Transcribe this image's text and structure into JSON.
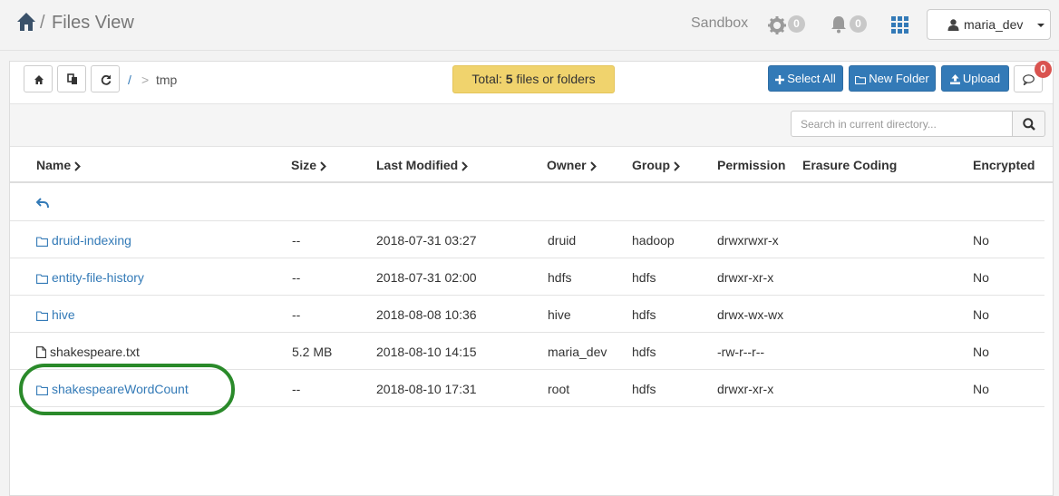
{
  "header": {
    "breadcrumb_sep": "/",
    "title": "Files View",
    "sandbox": "Sandbox",
    "settings_count": "0",
    "notifications_count": "0",
    "user": "maria_dev",
    "icons": [
      "home-icon",
      "gear-icon",
      "bell-icon",
      "apps-grid-icon",
      "user-icon",
      "chevron-down-icon"
    ]
  },
  "toolbar": {
    "path_root": "/",
    "path_sep": ">",
    "path_dir": "tmp",
    "total_prefix": "Total: ",
    "total_count": "5",
    "total_suffix": " files or folders",
    "select_all": "Select All",
    "new_folder": "New Folder",
    "upload": "Upload",
    "chat_count": "0",
    "accent": "#337ab7",
    "total_color": "#f0d36d"
  },
  "search": {
    "placeholder": "Search in current directory..."
  },
  "table": {
    "columns": [
      "Name",
      "Size",
      "Last Modified",
      "Owner",
      "Group",
      "Permission",
      "Erasure Coding",
      "Encrypted"
    ],
    "rows": [
      {
        "name": "druid-indexing",
        "type": "folder",
        "size": "--",
        "modified": "2018-07-31 03:27",
        "owner": "druid",
        "group": "hadoop",
        "permission": "drwxrwxr-x",
        "erasure": "",
        "encrypted": "No"
      },
      {
        "name": "entity-file-history",
        "type": "folder",
        "size": "--",
        "modified": "2018-07-31 02:00",
        "owner": "hdfs",
        "group": "hdfs",
        "permission": "drwxr-xr-x",
        "erasure": "",
        "encrypted": "No"
      },
      {
        "name": "hive",
        "type": "folder",
        "size": "--",
        "modified": "2018-08-08 10:36",
        "owner": "hive",
        "group": "hdfs",
        "permission": "drwx-wx-wx",
        "erasure": "",
        "encrypted": "No"
      },
      {
        "name": "shakespeare.txt",
        "type": "file",
        "size": "5.2 MB",
        "modified": "2018-08-10 14:15",
        "owner": "maria_dev",
        "group": "hdfs",
        "permission": "-rw-r--r--",
        "erasure": "",
        "encrypted": "No"
      },
      {
        "name": "shakespeareWordCount",
        "type": "folder",
        "size": "--",
        "modified": "2018-08-10 17:31",
        "owner": "root",
        "group": "hdfs",
        "permission": "drwxr-xr-x",
        "erasure": "",
        "encrypted": "No"
      }
    ],
    "highlight_color": "#2a8a2a"
  }
}
